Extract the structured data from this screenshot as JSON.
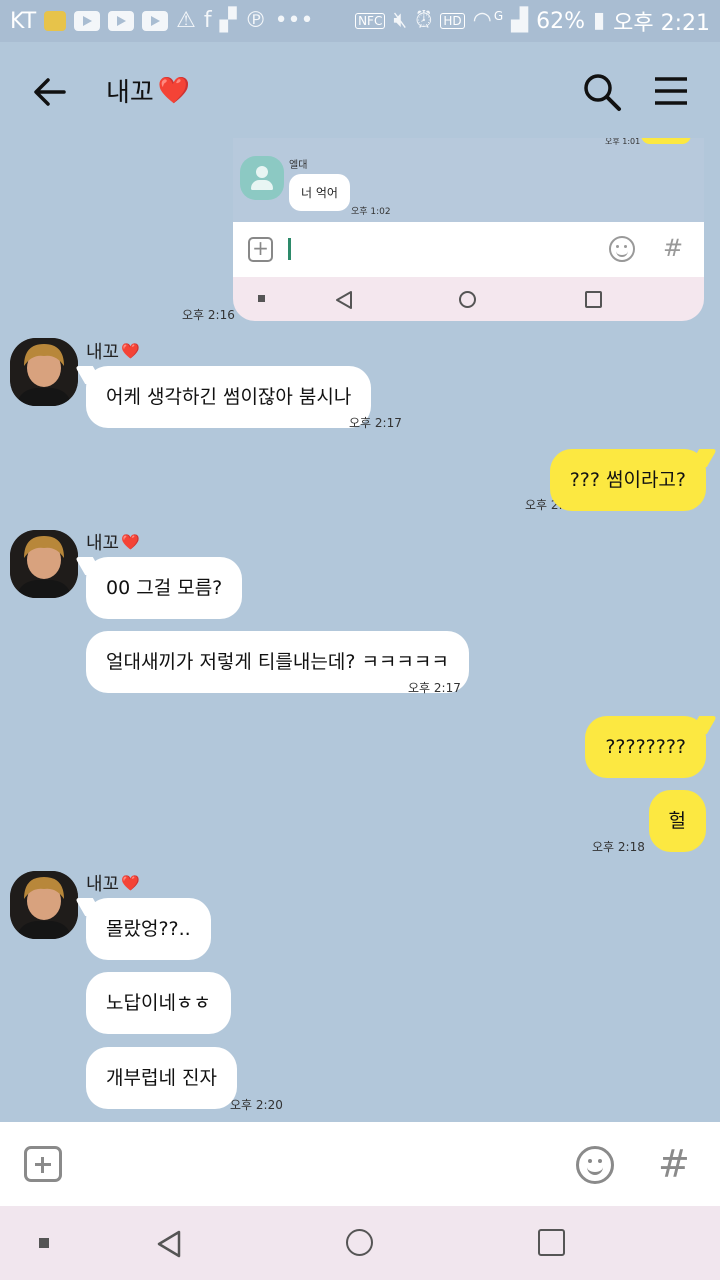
{
  "status_bar": {
    "carrier": "KT",
    "nfc": "NFC",
    "network": "G",
    "battery": "62%",
    "time": "오후 2:21"
  },
  "header": {
    "title": "내꼬",
    "title_emoji": "❤️"
  },
  "embedded_screenshot": {
    "sender": "엘대",
    "message": "너 억어",
    "time": "오후 1:02",
    "top_time": "오후 1:01"
  },
  "messages": {
    "embed_time": "오후 2:16",
    "friend_name": "내꼬",
    "friend_emoji": "❤️",
    "group1": {
      "m1": "어케 생각하긴 썸이잖아 붐시나",
      "time": "오후 2:17"
    },
    "me1": {
      "m1": "??? 썸이라고?",
      "time": "오후 2:17"
    },
    "group2": {
      "m1": "00 그걸 모름?",
      "m2": "얼대새끼가 저렇게 티를내는데? ㅋㅋㅋㅋㅋ",
      "time": "오후 2:17"
    },
    "me2": {
      "m1": "????????",
      "m2": "헐",
      "time": "오후 2:18"
    },
    "group3": {
      "m1": "몰랐엉??..",
      "m2": "노답이네ㅎㅎ",
      "m3": "개부럽네 진자",
      "time": "오후 2:20"
    }
  },
  "input_bar": {
    "plus_icon": "plus-icon",
    "emoji_icon": "smiley-icon",
    "hash": "#"
  },
  "colors": {
    "chat_bg": "#b2c7da",
    "my_bubble": "#fce841",
    "friend_bubble": "#ffffff",
    "nav_bg": "#f1e6ee"
  }
}
